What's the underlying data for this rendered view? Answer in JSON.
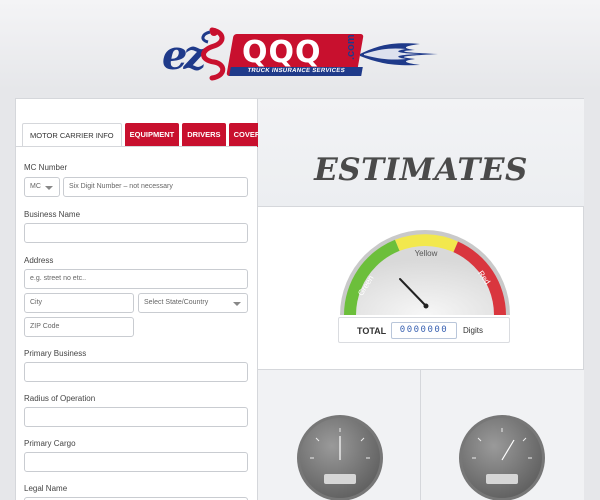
{
  "logo": {
    "mark": "ez",
    "brand": "QQQ",
    "domain_suffix": ".com",
    "tagline": "TRUCK INSURANCE SERVICES"
  },
  "form": {
    "tabs": [
      {
        "label": "MOTOR CARRIER INFO",
        "active": true
      },
      {
        "label": "EQUIPMENT",
        "active": false
      },
      {
        "label": "DRIVERS",
        "active": false
      },
      {
        "label": "COVERAGES",
        "active": false
      }
    ],
    "mc_number": {
      "label": "MC Number",
      "prefix_value": "MC",
      "placeholder": "Six Digit Number – not necessary"
    },
    "business_name": {
      "label": "Business Name",
      "value": ""
    },
    "address": {
      "label": "Address",
      "street_placeholder": "e.g. street no etc..",
      "city_placeholder": "City",
      "state_placeholder": "Select State/Country",
      "zip_placeholder": "ZIP Code"
    },
    "primary_business": {
      "label": "Primary Business",
      "value": ""
    },
    "radius_of_operation": {
      "label": "Radius of Operation",
      "value": ""
    },
    "primary_cargo": {
      "label": "Primary Cargo",
      "value": ""
    },
    "legal_name": {
      "label": "Legal Name",
      "value": ""
    }
  },
  "estimates": {
    "title": "ESTIMATES",
    "gauge": {
      "zones": [
        {
          "label": "Green",
          "color": "#6cbf3b"
        },
        {
          "label": "Yellow",
          "color": "#f2e84d"
        },
        {
          "label": "Red",
          "color": "#d9363e"
        }
      ]
    },
    "total": {
      "label": "TOTAL",
      "value": "0000000",
      "unit": "Digits"
    }
  },
  "colors": {
    "brand_red": "#c8102e",
    "brand_blue": "#1f3a8a",
    "digits_blue": "#3b63b3"
  }
}
